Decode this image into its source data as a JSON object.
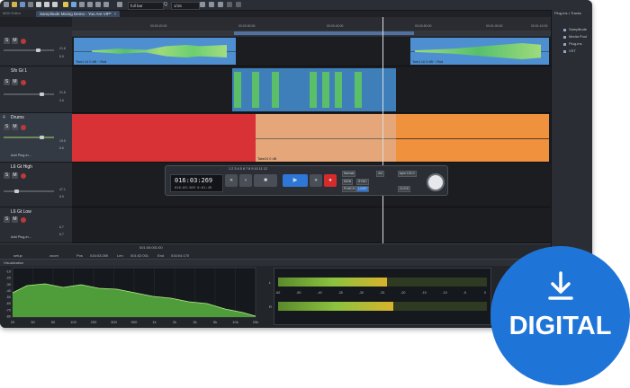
{
  "window": {
    "title_tab": "Samplitude Mixing Demo - You Are VIP*",
    "tab_close": "×",
    "editor_label": "MIDI Editor"
  },
  "toolbar": {
    "fullbar_value": "full bar",
    "ratio_value": "1/16",
    "q_label": "Q"
  },
  "ruler": {
    "ticks": [
      "00:00:20:00",
      "00:00:30:00",
      "00:00:40:00",
      "00:00:50:00",
      "00:01:00:00",
      "00:01:10:00"
    ]
  },
  "tracks": [
    {
      "name": "",
      "vol": "21.8",
      "pan": "5.9"
    },
    {
      "num": "",
      "name": "Sfx Gt 1",
      "vol": "21.8",
      "pan": "0.0"
    },
    {
      "num": "4",
      "name": "Drums",
      "vol": "19.5",
      "pan": "6.6",
      "plugin": "Add Plug-in..."
    },
    {
      "num": "",
      "name": "L6 Gt High",
      "vol": "47.1",
      "pan": "5.9"
    },
    {
      "num": "",
      "name": "L6 Gt Low",
      "vol": "6.7",
      "pan": "6.7",
      "plugin": "Add Plug-in..."
    }
  ],
  "objects": {
    "tom_left": "Tom1 UI  0 dB  ~.Rod",
    "tom_right": "Tom1 UI  0 dB  ~.Rod",
    "drums_take": "Take24  0 dB"
  },
  "transport": {
    "time_main": "016:03:269",
    "time_sub": "016:03:269   0:01:49",
    "bar_numbers": "1  2  3  4  5  6  7  8  9  10  11  12",
    "tempo_label": "Norm 120.0",
    "mode_label": "Normal",
    "sync_label": "SYNC",
    "punch_label": "PUNCH",
    "loop_label": "LOOP",
    "mon_label": "MON",
    "click_label": "CLICK",
    "sig_label": "4/4",
    "beats_label": "bpm 120.0"
  },
  "statusbar": {
    "pos_label": "Pos",
    "pos_value": "016:03:269",
    "len_label": "Len",
    "len_value": "001:02:001",
    "end_label": "End",
    "end_value": "016:04:170",
    "setup_label": "setup",
    "zoom_label": "zoom",
    "bar_range": "001:00:001:00"
  },
  "meterbar": {
    "title": "Visualization"
  },
  "spectrum": {
    "y_ticks": [
      "-10",
      "-20",
      "-30",
      "-40",
      "-50",
      "-60",
      "-70",
      "-80"
    ],
    "x_ticks": [
      "20",
      "30",
      "50",
      "100",
      "200",
      "300",
      "500",
      "1k",
      "2k",
      "3k",
      "5k",
      "10k",
      "20k"
    ]
  },
  "level_meter": {
    "scale": [
      "-60",
      "-50",
      "-40",
      "-35",
      "-30",
      "-25",
      "-20",
      "-15",
      "-10",
      "-5",
      "0"
    ],
    "channels": [
      "L",
      "R"
    ],
    "levels": [
      0.52,
      0.55
    ]
  },
  "right_panel": {
    "header": "Plug-ins • Tracks",
    "items": [
      "Samplitude",
      "Media Pool",
      "Plug-ins",
      "VST"
    ]
  },
  "badge": {
    "label": "DIGITAL",
    "download_icon": "download-icon"
  },
  "colors": {
    "red_object": "#d83236",
    "orange_object": "#f0913e",
    "peach_object": "#e5a77a",
    "blue_object": "#3d7fc1",
    "green_wave": "#7fd16a",
    "badge": "#1f74d8"
  }
}
